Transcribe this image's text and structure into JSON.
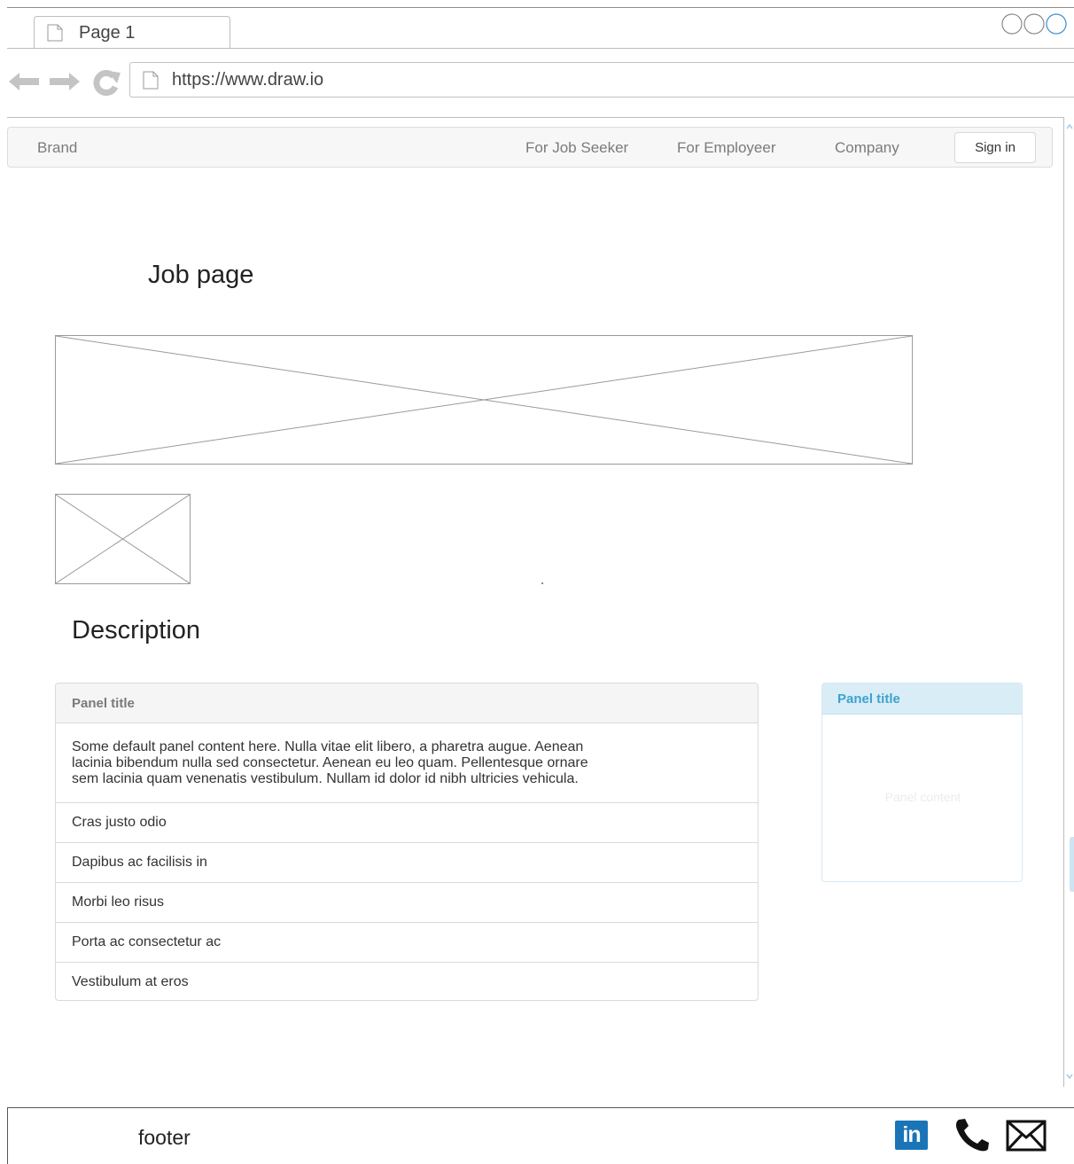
{
  "browser": {
    "tab_label": "Page 1",
    "url": "https://www.draw.io"
  },
  "navbar": {
    "brand": "Brand",
    "links": [
      "For Job Seeker",
      "For Employeer",
      "Company"
    ],
    "signin_label": "Sign in"
  },
  "main": {
    "page_title": "Job page",
    "description_title": "Description"
  },
  "list_panel": {
    "title": "Panel title",
    "body": "Some default panel content here. Nulla vitae elit libero, a pharetra augue. Aenean\nlacinia bibendum nulla sed consectetur. Aenean eu leo quam. Pellentesque ornare\nsem lacinia quam venenatis vestibulum. Nullam id dolor id nibh ultricies vehicula.",
    "items": [
      "Cras justo odio",
      "Dapibus ac facilisis in",
      "Morbi leo risus",
      "Porta ac consectetur ac",
      "Vestibulum at eros"
    ]
  },
  "side_panel": {
    "title": "Panel title",
    "content": "Panel content"
  },
  "footer": {
    "text": "footer",
    "linkedin_label": "in",
    "icons": [
      "linkedin-icon",
      "phone-icon",
      "mail-icon"
    ]
  },
  "colors": {
    "side_panel_header_bg": "#d9edf7",
    "side_panel_title": "#3ca3cf",
    "linkedin_blue": "#1a75b8"
  }
}
